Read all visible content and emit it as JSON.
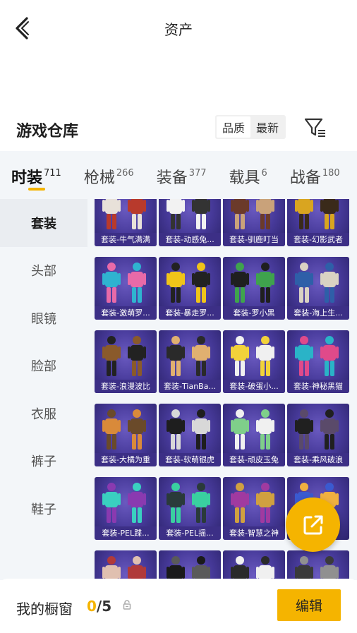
{
  "header": {
    "title": "资产"
  },
  "section": {
    "title": "游戏仓库",
    "sort_options": [
      "品质",
      "最新"
    ]
  },
  "tabs": [
    {
      "label": "时装",
      "count": "711"
    },
    {
      "label": "枪械",
      "count": "266"
    },
    {
      "label": "装备",
      "count": "377"
    },
    {
      "label": "载具",
      "count": "6"
    },
    {
      "label": "战备",
      "count": "180"
    }
  ],
  "subnav": [
    "套装",
    "头部",
    "眼镜",
    "脸部",
    "衣服",
    "裤子",
    "鞋子"
  ],
  "items": [
    "套装-牛气满满",
    "套装-动感兔...",
    "套装-驯鹿叮当",
    "套装-幻影武者",
    "套装-激萌罗...",
    "套装-暴走罗...",
    "套装-罗小黑",
    "套装-海上生...",
    "套装-浪漫波比",
    "套装-TianBa...",
    "套装-破蛋小...",
    "套装-神秘黑猫",
    "套装-大橘为重",
    "套装-软萌银虎",
    "套装-顽皮玉兔",
    "套装-乘风破浪",
    "套装-PEL蹀...",
    "套装-PEL摇...",
    "套装-智慧之神",
    "",
    "",
    "",
    "",
    ""
  ],
  "bottom": {
    "label": "我的橱窗",
    "current": "0",
    "total": "/5",
    "edit_label": "编辑"
  },
  "colors": {
    "accent": "#f5b400",
    "card": "#473a9a"
  }
}
